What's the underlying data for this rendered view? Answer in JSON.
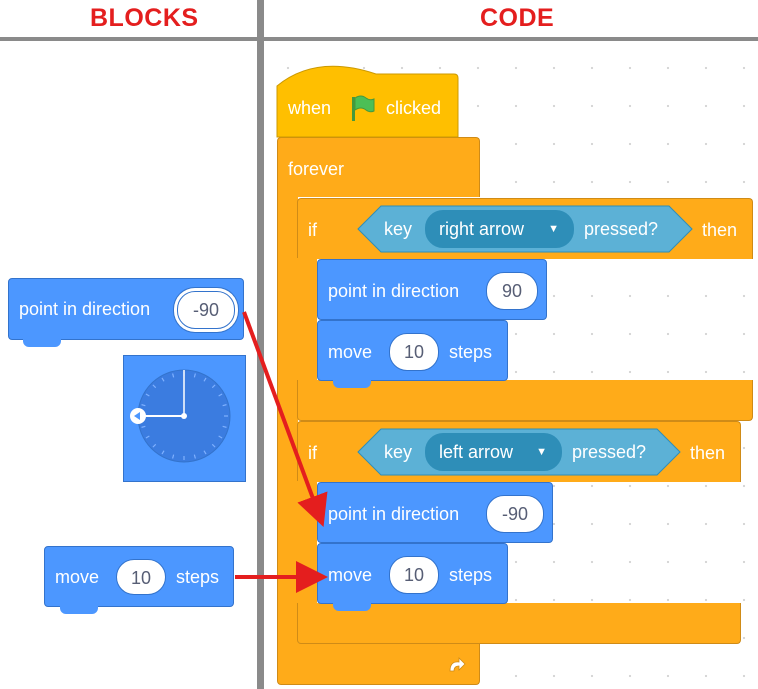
{
  "headers": {
    "left": "BLOCKS",
    "right": "CODE",
    "color": "#e41e1e"
  },
  "colors": {
    "motion": "#4c97ff",
    "control": "#ffab19",
    "events": "#ffbf00",
    "sensing": "#5cb1d6",
    "arrow": "#e41e1e"
  },
  "palette": {
    "point_block": {
      "label": "point in direction",
      "value": "-90"
    },
    "move_block": {
      "label_before": "move",
      "value": "10",
      "label_after": "steps"
    },
    "dial": {
      "direction": -90
    }
  },
  "script": {
    "hat": {
      "label_before": "when",
      "icon": "green-flag-icon",
      "label_after": "clicked"
    },
    "forever": {
      "label": "forever",
      "icon": "loop-arrow-icon"
    },
    "if1": {
      "if_label": "if",
      "key_label": "key",
      "key_value": "right arrow",
      "pressed_label": "pressed?",
      "then_label": "then",
      "point": {
        "label": "point in direction",
        "value": "90"
      },
      "move": {
        "label_before": "move",
        "value": "10",
        "label_after": "steps"
      }
    },
    "if2": {
      "if_label": "if",
      "key_label": "key",
      "key_value": "left arrow",
      "pressed_label": "pressed?",
      "then_label": "then",
      "point": {
        "label": "point in direction",
        "value": "-90"
      },
      "move": {
        "label_before": "move",
        "value": "10",
        "label_after": "steps"
      }
    }
  }
}
